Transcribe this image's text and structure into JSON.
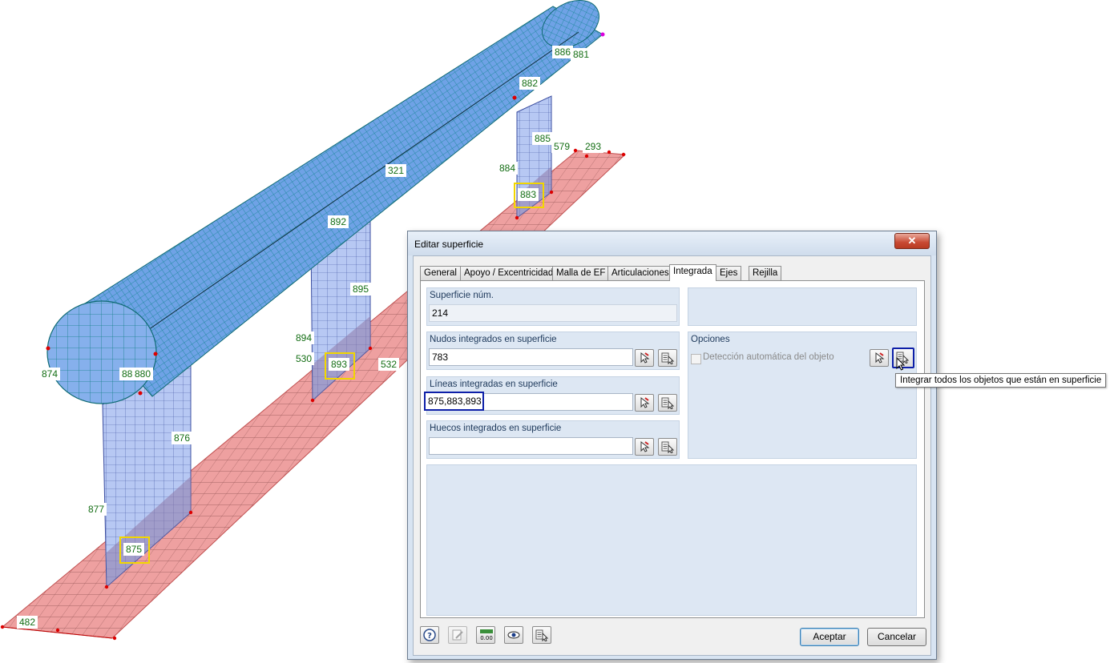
{
  "model": {
    "labels": {
      "l886": "886",
      "l881": "881",
      "l882": "882",
      "l885": "885",
      "l579": "579",
      "l293": "293",
      "l884": "884",
      "l883": "883",
      "l321": "321",
      "l892": "892",
      "l895": "895",
      "l894": "894",
      "l530": "530",
      "l893": "893",
      "l532": "532",
      "l874": "874",
      "l88x": "88",
      "l880": "880",
      "l876": "876",
      "l877": "877",
      "l875": "875",
      "l482": "482"
    },
    "colors": {
      "cylinder": "#6fa2e6",
      "mesh": "#137f8a",
      "wall": "#b4c6f2",
      "slab": "#eea0a0",
      "label_text": "#146e14",
      "highlight": "#f2d600"
    }
  },
  "dialog": {
    "title": "Editar superficie",
    "close_symbol": "✕",
    "tabs": [
      "General",
      "Apoyo / Excentricidad",
      "Malla de EF",
      "Articulaciones",
      "Integrada",
      "Ejes",
      "Rejilla"
    ],
    "active_tab": "Integrada",
    "surface_no": {
      "label": "Superficie núm.",
      "value": "214"
    },
    "nodes": {
      "label": "Nudos integrados en superficie",
      "value": "783"
    },
    "lines": {
      "label": "Líneas integradas en superficie",
      "value": "875,883,893"
    },
    "openings": {
      "label": "Huecos integrados en superficie",
      "value": ""
    },
    "options": {
      "label": "Opciones",
      "auto_detect_label": "Detección automática del objeto",
      "auto_detect_checked": false
    },
    "tooltip": "Integrar todos los objetos que están en superficie",
    "ok_label": "Aceptar",
    "cancel_label": "Cancelar",
    "units_icon_text": "0.00"
  }
}
